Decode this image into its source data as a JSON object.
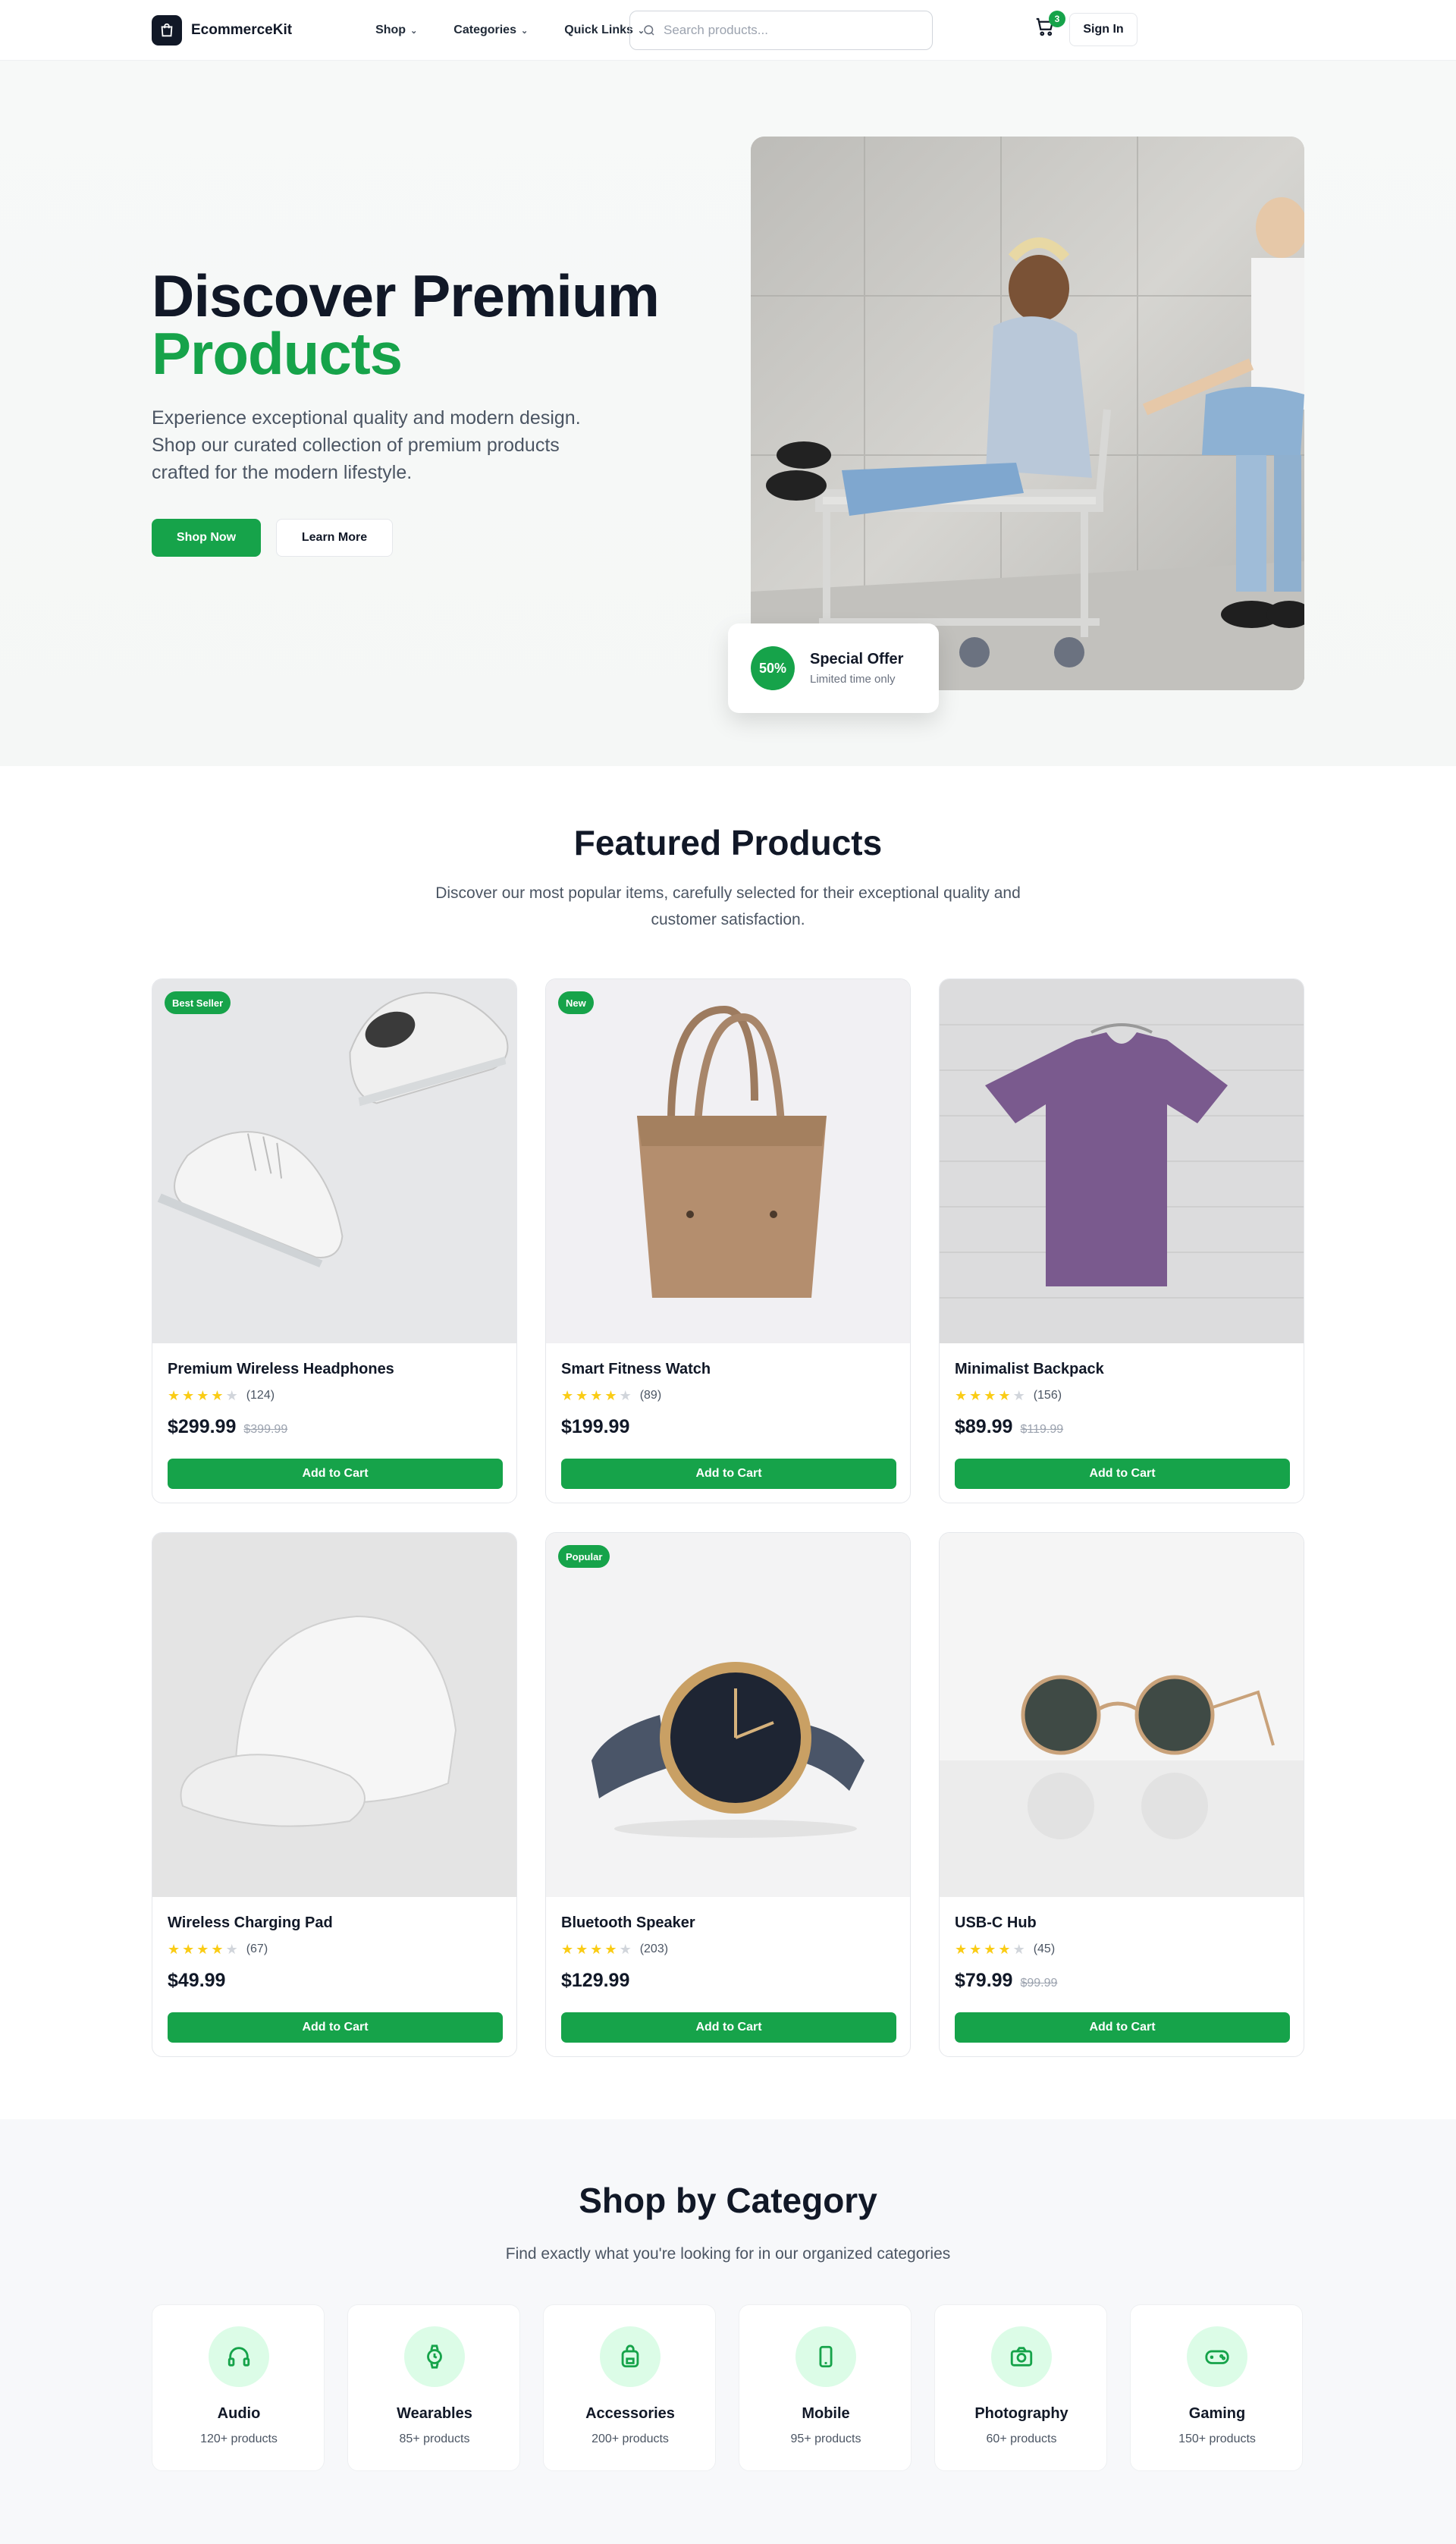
{
  "colors": {
    "accent": "#16a34a",
    "text": "#111827",
    "muted": "#4b5563",
    "star": "#facc15"
  },
  "nav": {
    "brand": "EcommerceKit",
    "links": [
      "Shop",
      "Categories",
      "Quick Links"
    ],
    "search_placeholder": "Search products...",
    "cart_count": "3",
    "signin": "Sign In"
  },
  "hero": {
    "title_line1": "Discover Premium",
    "title_line2": "Products",
    "subtitle": "Experience exceptional quality and modern design. Shop our curated collection of premium products crafted for the modern lifestyle.",
    "primary_cta": "Shop Now",
    "secondary_cta": "Learn More",
    "offer_badge": "50%",
    "offer_title": "Special Offer",
    "offer_sub": "Limited time only"
  },
  "featured": {
    "title": "Featured Products",
    "subtitle": "Discover our most popular items, carefully selected for their exceptional quality and customer satisfaction.",
    "add_label": "Add to Cart",
    "products": [
      {
        "name": "Premium Wireless Headphones",
        "rating": 4,
        "reviews": "(124)",
        "price": "$299.99",
        "old_price": "$399.99",
        "tag": "Best Seller",
        "image": "sneakers"
      },
      {
        "name": "Smart Fitness Watch",
        "rating": 4,
        "reviews": "(89)",
        "price": "$199.99",
        "old_price": "",
        "tag": "New",
        "image": "handbag"
      },
      {
        "name": "Minimalist Backpack",
        "rating": 4,
        "reviews": "(156)",
        "price": "$89.99",
        "old_price": "$119.99",
        "tag": "",
        "image": "tshirt"
      },
      {
        "name": "Wireless Charging Pad",
        "rating": 4,
        "reviews": "(67)",
        "price": "$49.99",
        "old_price": "",
        "tag": "",
        "image": "cap"
      },
      {
        "name": "Bluetooth Speaker",
        "rating": 4,
        "reviews": "(203)",
        "price": "$129.99",
        "old_price": "",
        "tag": "Popular",
        "image": "watch"
      },
      {
        "name": "USB-C Hub",
        "rating": 4,
        "reviews": "(45)",
        "price": "$79.99",
        "old_price": "$99.99",
        "tag": "",
        "image": "sunglasses"
      }
    ]
  },
  "categories": {
    "title": "Shop by Category",
    "subtitle": "Find exactly what you're looking for in our organized categories",
    "items": [
      {
        "name": "Audio",
        "count": "120+ products",
        "icon": "headphones-icon"
      },
      {
        "name": "Wearables",
        "count": "85+ products",
        "icon": "watch-icon"
      },
      {
        "name": "Accessories",
        "count": "200+ products",
        "icon": "backpack-icon"
      },
      {
        "name": "Mobile",
        "count": "95+ products",
        "icon": "smartphone-icon"
      },
      {
        "name": "Photography",
        "count": "60+ products",
        "icon": "camera-icon"
      },
      {
        "name": "Gaming",
        "count": "150+ products",
        "icon": "gamepad-icon"
      }
    ]
  }
}
